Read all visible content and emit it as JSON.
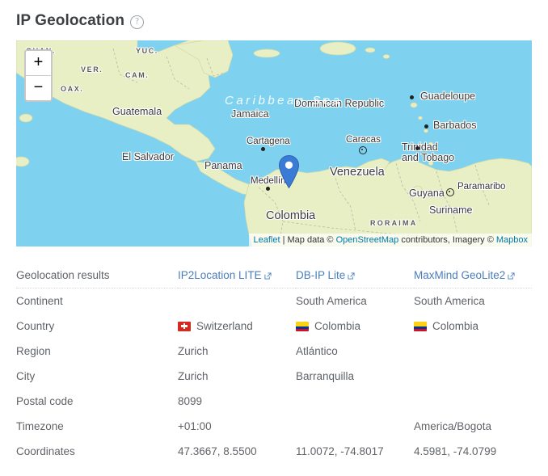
{
  "header": {
    "title": "IP Geolocation",
    "help_icon": "question-mark-circle-icon"
  },
  "map": {
    "zoom_in_label": "+",
    "zoom_out_label": "−",
    "marker": {
      "icon": "map-pin-icon",
      "near": "Cartagena"
    },
    "attribution": {
      "leaflet": "Leaflet",
      "sep": " | ",
      "mapdata_prefix": "Map data © ",
      "osm": "OpenStreetMap",
      "contrib": " contributors, Imagery © ",
      "mapbox": "Mapbox"
    },
    "labels": {
      "sea": "Caribbean Sea",
      "states": [
        "GUAN.",
        "YUC.",
        "VER.",
        "CAM.",
        "OAX.",
        "RORAIMA"
      ],
      "countries": [
        "Guatemala",
        "El Salvador",
        "Jamaica",
        "Dominican Republic",
        "Guadeloupe",
        "Barbados",
        "Trinidad",
        "and Tobago",
        "Panama",
        "Colombia",
        "Venezuela",
        "Guyana",
        "Suriname"
      ],
      "cities": [
        "Cartagena",
        "Caracas",
        "Medellín",
        "Paramaribo"
      ]
    },
    "colors": {
      "ocean": "#7ed2f0",
      "land": "#e8efc5",
      "marker": "#3a7bd5",
      "link": "#0078A8"
    }
  },
  "table": {
    "row_label_header": "Geolocation results",
    "providers": [
      {
        "name": "IP2Location LITE",
        "icon": "external-link-icon"
      },
      {
        "name": "DB-IP Lite",
        "icon": "external-link-icon"
      },
      {
        "name": "MaxMind GeoLite2",
        "icon": "external-link-icon"
      }
    ],
    "rows": [
      {
        "label": "Continent",
        "cells": [
          {
            "text": ""
          },
          {
            "text": "South America"
          },
          {
            "text": "South America"
          }
        ]
      },
      {
        "label": "Country",
        "cells": [
          {
            "text": "Switzerland",
            "flag": "ch"
          },
          {
            "text": "Colombia",
            "flag": "co"
          },
          {
            "text": "Colombia",
            "flag": "co"
          }
        ]
      },
      {
        "label": "Region",
        "cells": [
          {
            "text": "Zurich"
          },
          {
            "text": "Atlántico"
          },
          {
            "text": ""
          }
        ]
      },
      {
        "label": "City",
        "cells": [
          {
            "text": "Zurich"
          },
          {
            "text": "Barranquilla"
          },
          {
            "text": ""
          }
        ]
      },
      {
        "label": "Postal code",
        "cells": [
          {
            "text": "8099"
          },
          {
            "text": ""
          },
          {
            "text": ""
          }
        ]
      },
      {
        "label": "Timezone",
        "cells": [
          {
            "text": "+01:00"
          },
          {
            "text": ""
          },
          {
            "text": "America/Bogota"
          }
        ]
      },
      {
        "label": "Coordinates",
        "cells": [
          {
            "text": "47.3667, 8.5500"
          },
          {
            "text": "11.0072, -74.8017"
          },
          {
            "text": "4.5981, -74.0799"
          }
        ]
      }
    ]
  }
}
